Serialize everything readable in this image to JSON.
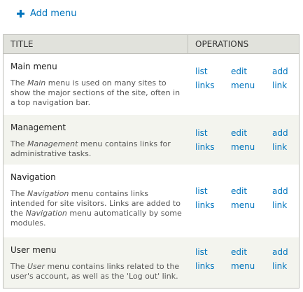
{
  "actions": {
    "add_menu_label": "Add menu"
  },
  "table": {
    "headers": {
      "title": "TITLE",
      "operations": "OPERATIONS"
    },
    "rows": [
      {
        "name": "Main menu",
        "desc_pre": "The ",
        "desc_em": "Main",
        "desc_post": " menu is used on many sites to show the major sections of the site, often in a top navigation bar.",
        "ops": {
          "list_a": "list",
          "list_b": "links",
          "edit_a": "edit",
          "edit_b": "menu",
          "add_a": "add",
          "add_b": "link"
        }
      },
      {
        "name": "Management",
        "desc_pre": "The ",
        "desc_em": "Management",
        "desc_post": " menu contains links for administrative tasks.",
        "ops": {
          "list_a": "list",
          "list_b": "links",
          "edit_a": "edit",
          "edit_b": "menu",
          "add_a": "add",
          "add_b": "link"
        }
      },
      {
        "name": "Navigation",
        "desc_pre": "The ",
        "desc_em": "Navigation",
        "desc_post": " menu contains links intended for site visitors. Links are added to the ",
        "desc_em2": "Navigation",
        "desc_post2": " menu automatically by some modules.",
        "ops": {
          "list_a": "list",
          "list_b": "links",
          "edit_a": "edit",
          "edit_b": "menu",
          "add_a": "add",
          "add_b": "link"
        }
      },
      {
        "name": "User menu",
        "desc_pre": "The ",
        "desc_em": "User",
        "desc_post": " menu contains links related to the user's account, as well as the 'Log out' link.",
        "ops": {
          "list_a": "list",
          "list_b": "links",
          "edit_a": "edit",
          "edit_b": "menu",
          "add_a": "add",
          "add_b": "link"
        }
      }
    ]
  },
  "colors": {
    "link": "#0074bd",
    "header_bg": "#e1e2dc",
    "row_alt_bg": "#f3f4ee",
    "border": "#bfbfba"
  }
}
